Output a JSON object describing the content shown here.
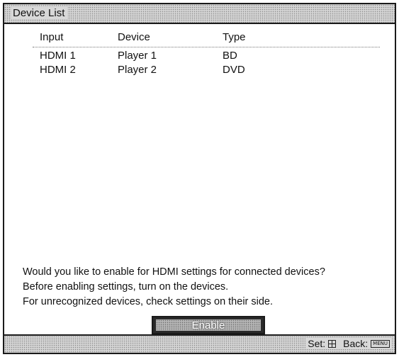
{
  "window": {
    "title": "Device List"
  },
  "table": {
    "headers": {
      "input": "Input",
      "device": "Device",
      "type": "Type"
    },
    "rows": [
      {
        "input": "HDMI 1",
        "device": "Player 1",
        "type": "BD"
      },
      {
        "input": "HDMI 2",
        "device": "Player 2",
        "type": "DVD"
      }
    ]
  },
  "message": {
    "line1": "Would you like to enable for HDMI settings for connected devices?",
    "line2": "Before enabling settings, turn on the devices.",
    "line3": "For unrecognized devices, check settings on their side."
  },
  "enable_button": {
    "label": "Enable"
  },
  "status_bar": {
    "set_label": "Set:",
    "set_icon": "enter-button-icon",
    "back_label": "Back:",
    "back_icon_text": "MENU"
  }
}
